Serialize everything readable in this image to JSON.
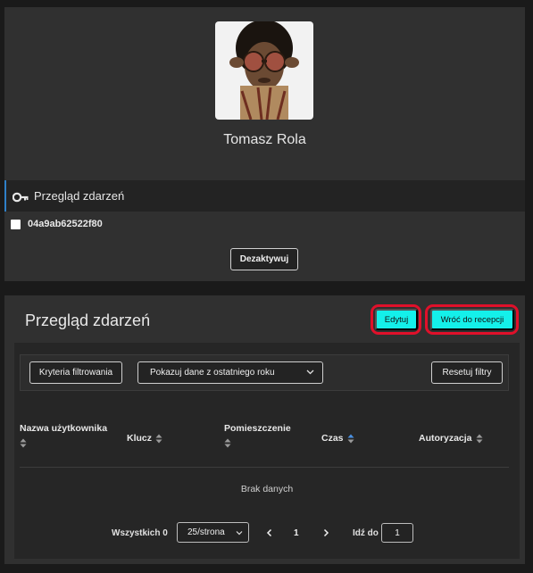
{
  "profile": {
    "name": "Tomasz Rola",
    "section_title": "Przegląd zdarzeń",
    "card_id": "04a9ab62522f80",
    "deactivate_label": "Dezaktywuj"
  },
  "events": {
    "title": "Przegląd zdarzeń",
    "edit_label": "Edytuj",
    "back_label": "Wróć do recepcji",
    "filters": {
      "criteria_label": "Kryteria filtrowania",
      "range_value": "Pokazuj dane z ostatniego roku",
      "reset_label": "Resetuj filtry"
    },
    "columns": [
      "Nazwa użytkownika",
      "Klucz",
      "Pomieszczenie",
      "Czas",
      "Autoryzacja"
    ],
    "empty_text": "Brak danych",
    "pagination": {
      "total_label": "Wszystkich 0",
      "per_page": "25/strona",
      "current_page": "1",
      "goto_label": "Idź do",
      "goto_value": "1"
    }
  },
  "colors": {
    "accent_cyan": "#14f0ea",
    "highlight_red": "#e0102a",
    "active_blue": "#2f80c8",
    "sort_active": "#4a90e2"
  }
}
